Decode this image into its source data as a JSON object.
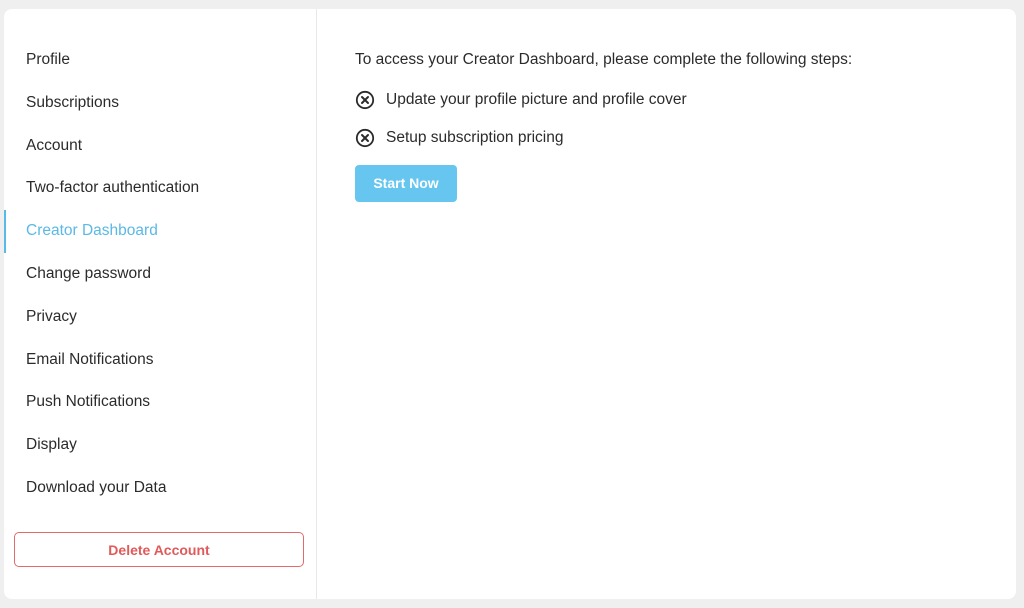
{
  "sidebar": {
    "items": [
      {
        "label": "Profile",
        "active": false
      },
      {
        "label": "Subscriptions",
        "active": false
      },
      {
        "label": "Account",
        "active": false
      },
      {
        "label": "Two-factor authentication",
        "active": false
      },
      {
        "label": "Creator Dashboard",
        "active": true
      },
      {
        "label": "Change password",
        "active": false
      },
      {
        "label": "Privacy",
        "active": false
      },
      {
        "label": "Email Notifications",
        "active": false
      },
      {
        "label": "Push Notifications",
        "active": false
      },
      {
        "label": "Display",
        "active": false
      },
      {
        "label": "Download your Data",
        "active": false
      }
    ],
    "delete_label": "Delete Account"
  },
  "main": {
    "intro": "To access your Creator Dashboard, please complete the following steps:",
    "steps": [
      {
        "label": "Update your profile picture and profile cover",
        "icon": "x-circle-icon",
        "status": "incomplete"
      },
      {
        "label": "Setup subscription pricing",
        "icon": "x-circle-icon",
        "status": "incomplete"
      }
    ],
    "start_label": "Start Now"
  },
  "colors": {
    "accent": "#5ab9e6",
    "button": "#66c6f0",
    "danger": "#e05a5a",
    "background": "#efefef",
    "card": "#ffffff"
  }
}
